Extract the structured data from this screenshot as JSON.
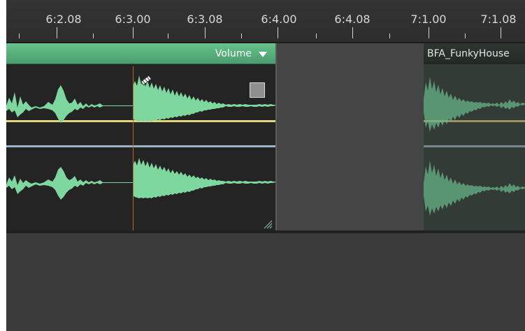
{
  "timeline": {
    "ruler_labels": [
      "6:2.08",
      "6:3.00",
      "6:3.08",
      "6:4.00",
      "6:4.08",
      "7:1.00",
      "7:1.08"
    ]
  },
  "clip_main": {
    "dropdown_label": "Volume",
    "icon": "chevron-down-icon"
  },
  "clip_right": {
    "title": "BFA_FunkyHouse"
  },
  "colors": {
    "clip_header_green": "#5cb57f",
    "waveform_green": "#7fd7a0",
    "yellow_line": "#e2d57e",
    "blue_line": "#9eb3c7",
    "playhead_orange": "#b86e21"
  }
}
